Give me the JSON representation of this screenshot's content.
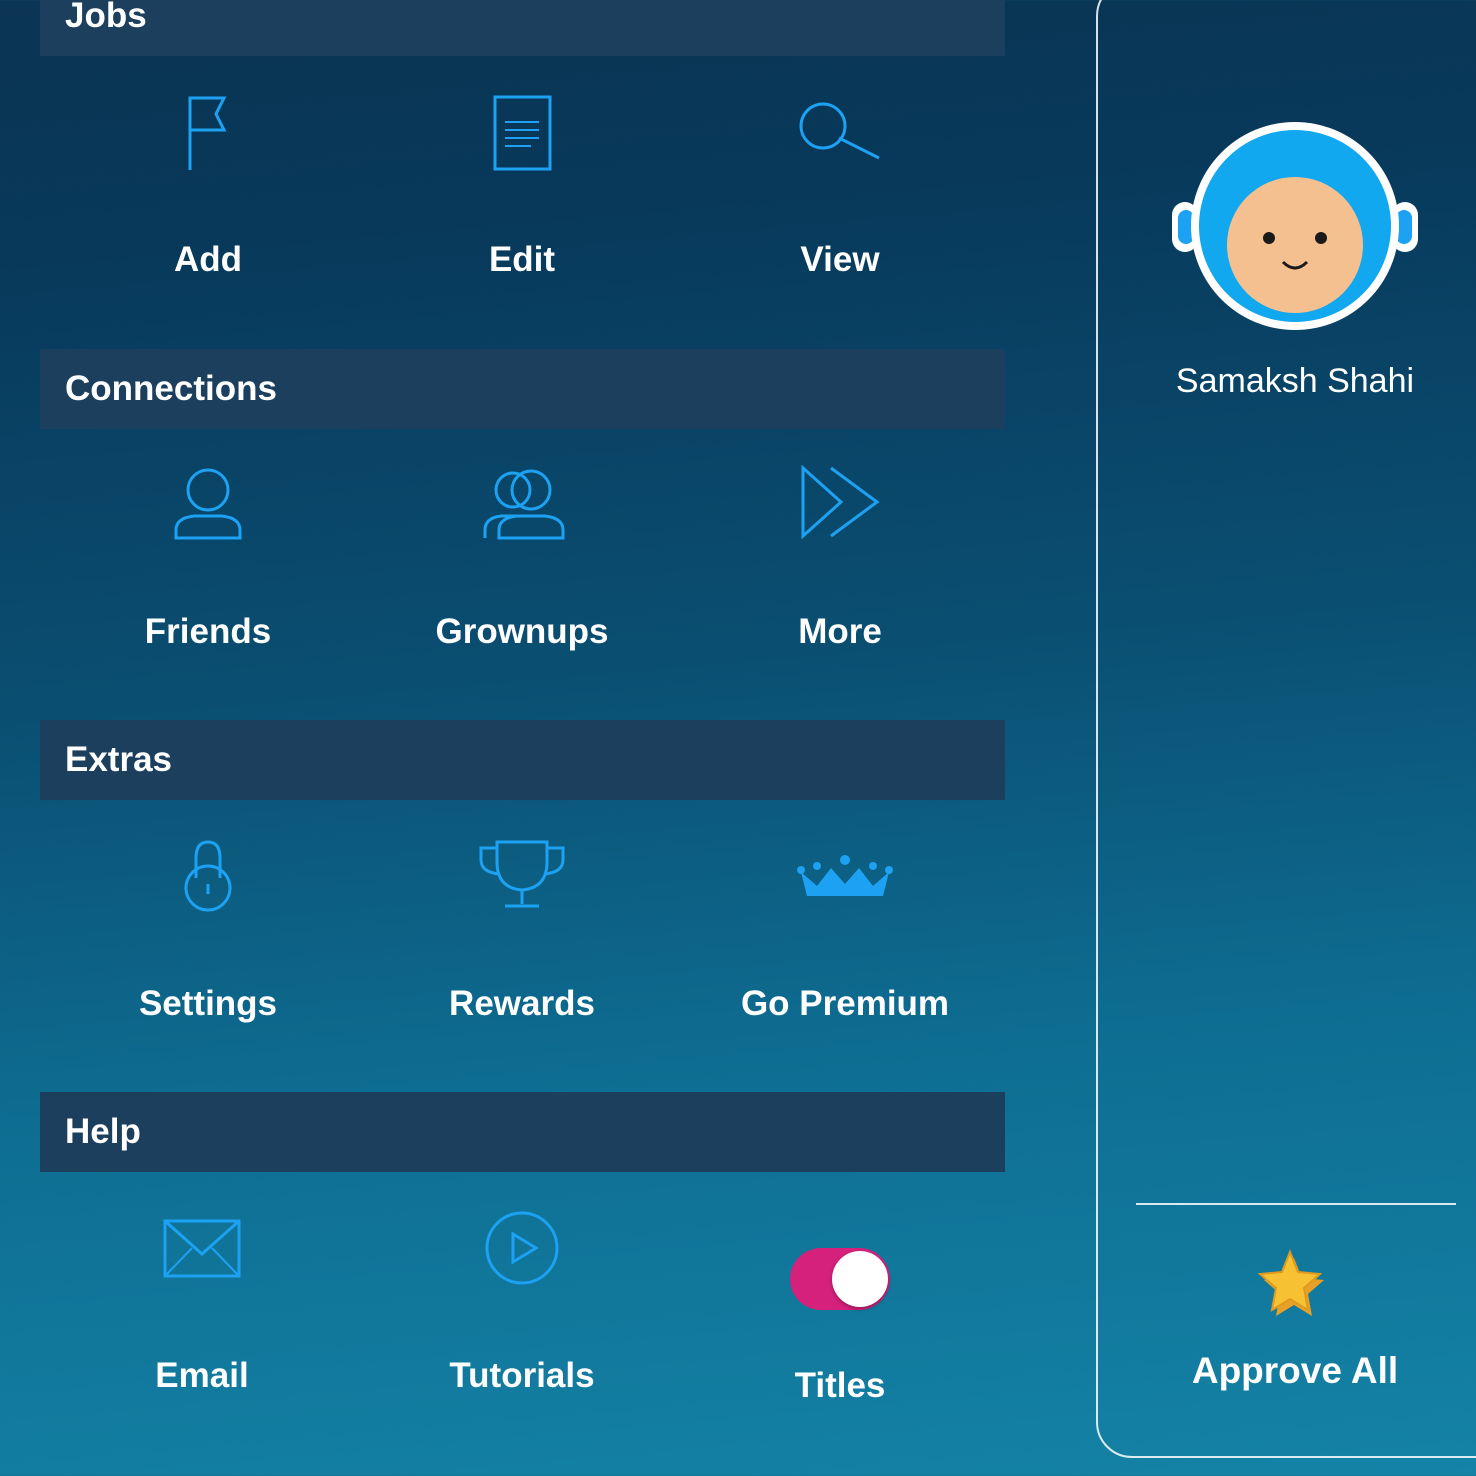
{
  "sections": {
    "jobs": {
      "title": "Jobs",
      "items": [
        {
          "label": "Add",
          "icon": "flag-icon"
        },
        {
          "label": "Edit",
          "icon": "document-icon"
        },
        {
          "label": "View",
          "icon": "search-icon"
        }
      ]
    },
    "connections": {
      "title": "Connections",
      "items": [
        {
          "label": "Friends",
          "icon": "user-icon"
        },
        {
          "label": "Grownups",
          "icon": "users-icon"
        },
        {
          "label": "More",
          "icon": "fast-forward-icon"
        }
      ]
    },
    "extras": {
      "title": "Extras",
      "items": [
        {
          "label": "Settings",
          "icon": "lock-icon"
        },
        {
          "label": "Rewards",
          "icon": "trophy-icon"
        },
        {
          "label": "Go Premium",
          "icon": "crown-icon"
        }
      ]
    },
    "help": {
      "title": "Help",
      "items": [
        {
          "label": "Email",
          "icon": "envelope-icon"
        },
        {
          "label": "Tutorials",
          "icon": "play-circle-icon"
        },
        {
          "label": "Titles",
          "icon": "toggle-switch",
          "toggle_on": true
        }
      ]
    }
  },
  "profile": {
    "name": "Samaksh Shahi",
    "avatar": "astronaut-avatar"
  },
  "approve_all": {
    "label": "Approve All",
    "icon": "star-stack-icon"
  },
  "colors": {
    "icon": "#1da1f2",
    "header_bg": "#1c3f5e",
    "toggle_on": "#d6217c"
  }
}
